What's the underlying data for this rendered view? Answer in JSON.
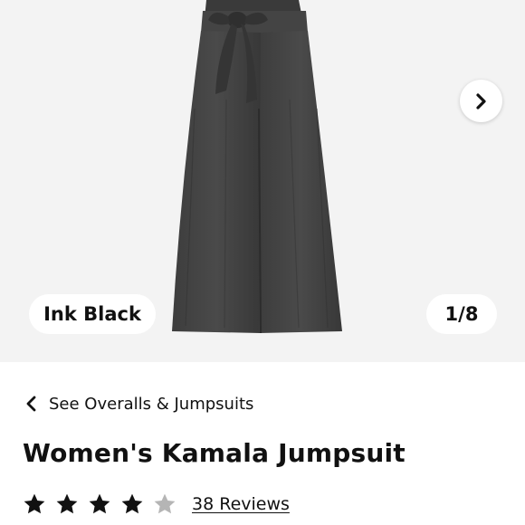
{
  "gallery": {
    "color_label": "Ink Black",
    "image_counter": "1/8",
    "next_icon": "chevron-right-icon",
    "image_subject": "jumpsuit-image"
  },
  "breadcrumb": {
    "back_icon": "chevron-left-icon",
    "label": "See Overalls & Jumpsuits"
  },
  "product": {
    "title": "Women's Kamala Jumpsuit",
    "rating": {
      "value": 4,
      "max": 5,
      "filled_color": "#111111",
      "empty_color": "#b5b5b5",
      "reviews_label": "38 Reviews"
    }
  }
}
